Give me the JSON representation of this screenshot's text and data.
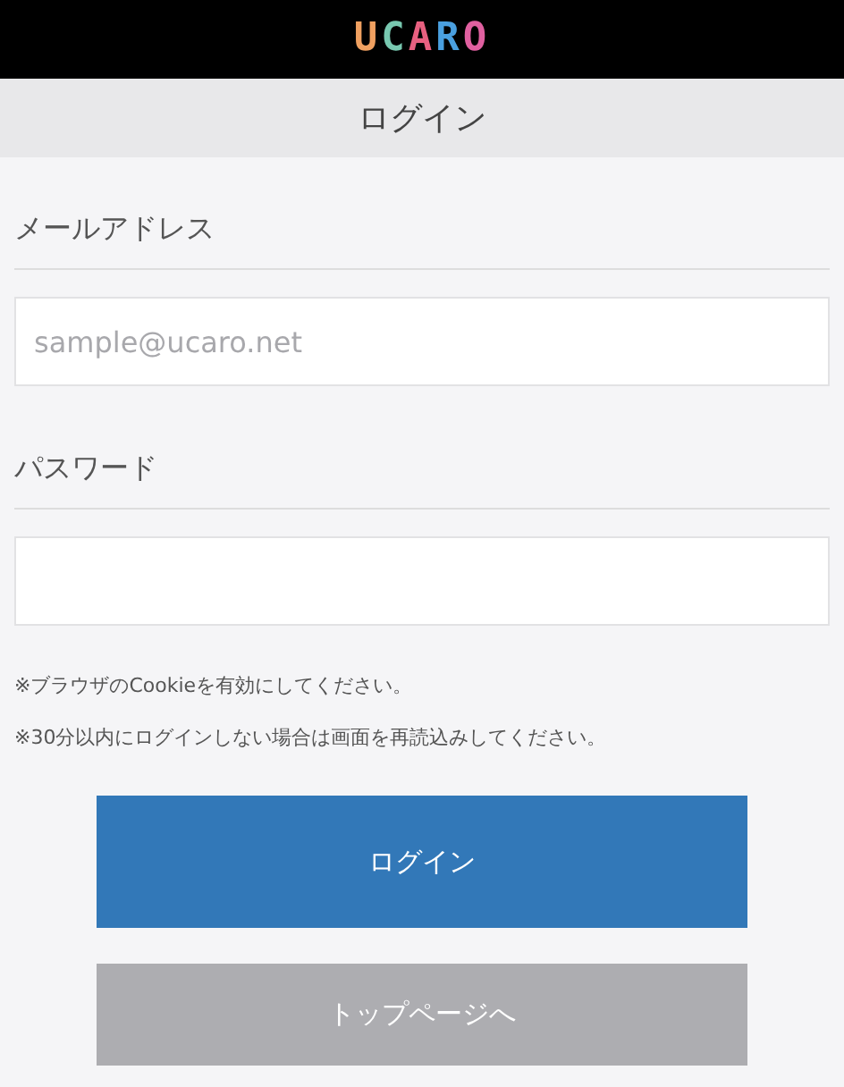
{
  "header": {
    "logo": [
      {
        "char": "U",
        "color": "#f0a060"
      },
      {
        "char": "C",
        "color": "#78c8b0"
      },
      {
        "char": "A",
        "color": "#e86080"
      },
      {
        "char": "R",
        "color": "#4aa0e0"
      },
      {
        "char": "O",
        "color": "#e060a0"
      }
    ]
  },
  "title": "ログイン",
  "fields": [
    {
      "label": "メールアドレス",
      "placeholder": "sample@ucaro.net"
    },
    {
      "label": "パスワード"
    }
  ],
  "notes": [
    "※ブラウザのCookieを有効にしてください。",
    "※30分以内にログインしない場合は画面を再読込みしてください。"
  ],
  "buttons": [
    {
      "label": "ログイン",
      "kind": "primary"
    },
    {
      "label": "トップページへ",
      "kind": "secondary"
    }
  ]
}
